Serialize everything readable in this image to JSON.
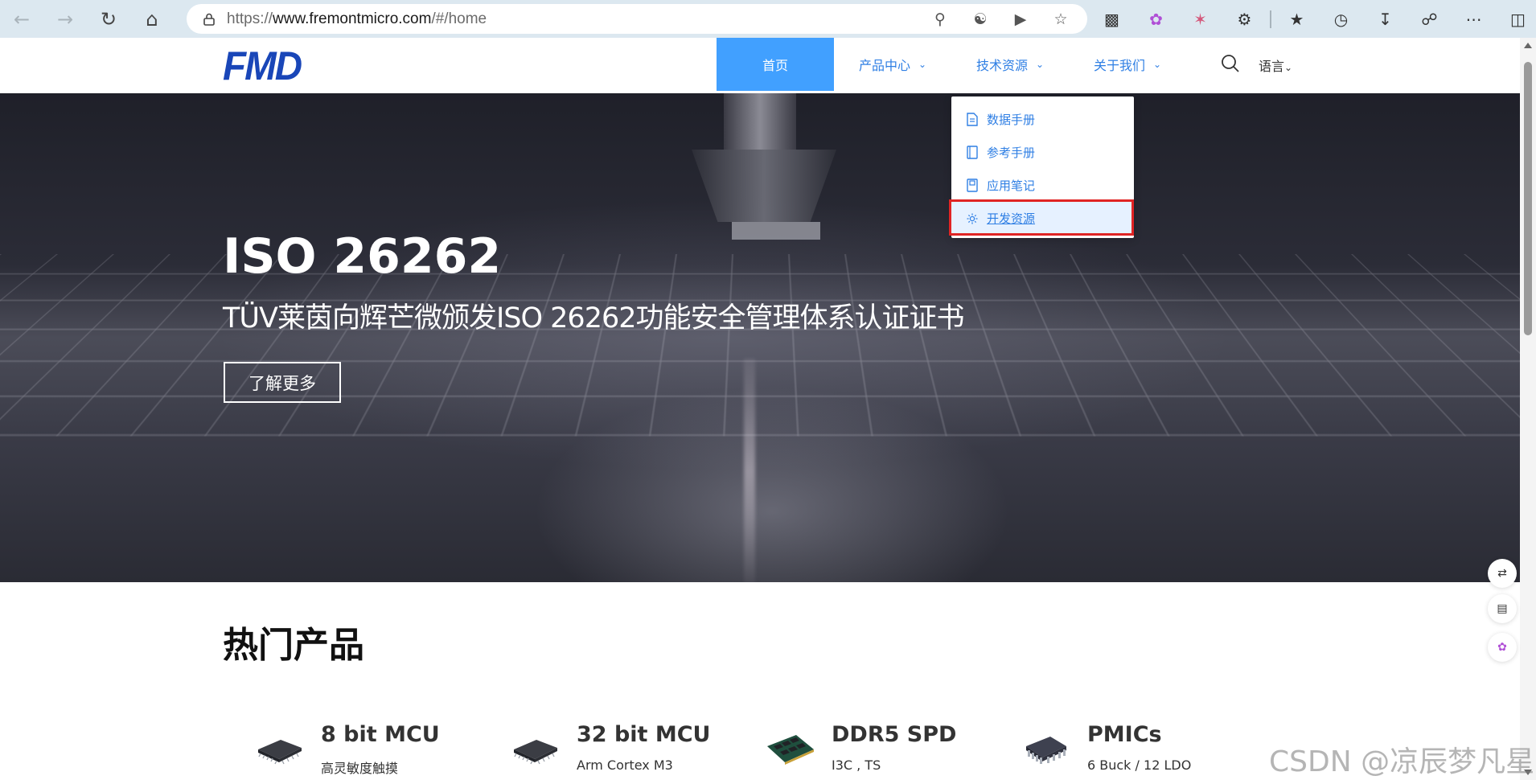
{
  "browser": {
    "url_prefix": "https://",
    "url_host": "www.fremontmicro.com",
    "url_path": "/#/home"
  },
  "site": {
    "logo": "FMD",
    "nav": [
      {
        "label": "首页",
        "active": true
      },
      {
        "label": "产品中心",
        "active": false
      },
      {
        "label": "技术资源",
        "active": false
      },
      {
        "label": "关于我们",
        "active": false
      }
    ],
    "language_label": "语言"
  },
  "dropdown": {
    "items": [
      {
        "label": "数据手册",
        "icon": "document-icon"
      },
      {
        "label": "参考手册",
        "icon": "book-icon"
      },
      {
        "label": "应用笔记",
        "icon": "notebook-icon"
      },
      {
        "label": "开发资源",
        "icon": "gear-icon",
        "highlighted": true
      }
    ]
  },
  "hero": {
    "title": "ISO 26262",
    "subtitle": "TÜV莱茵向辉芒微颁发ISO 26262功能安全管理体系认证证书",
    "button": "了解更多"
  },
  "hot_products": {
    "title": "热门产品",
    "items": [
      {
        "name": "8 bit MCU",
        "desc": "高灵敏度触摸",
        "icon": "chip-icon"
      },
      {
        "name": "32 bit MCU",
        "desc": "Arm Cortex M3",
        "icon": "chip-icon"
      },
      {
        "name": "DDR5 SPD",
        "desc": "I3C , TS",
        "icon": "memory-module-icon"
      },
      {
        "name": "PMICs",
        "desc": "6 Buck / 12 LDO",
        "icon": "soic-chip-icon"
      }
    ]
  },
  "watermark": "CSDN @凉辰梦凡星",
  "colors": {
    "brand_blue": "#1946b8",
    "nav_active_bg": "#41a0ff",
    "link_blue": "#2f7fe4",
    "highlight_red": "#e02424"
  }
}
